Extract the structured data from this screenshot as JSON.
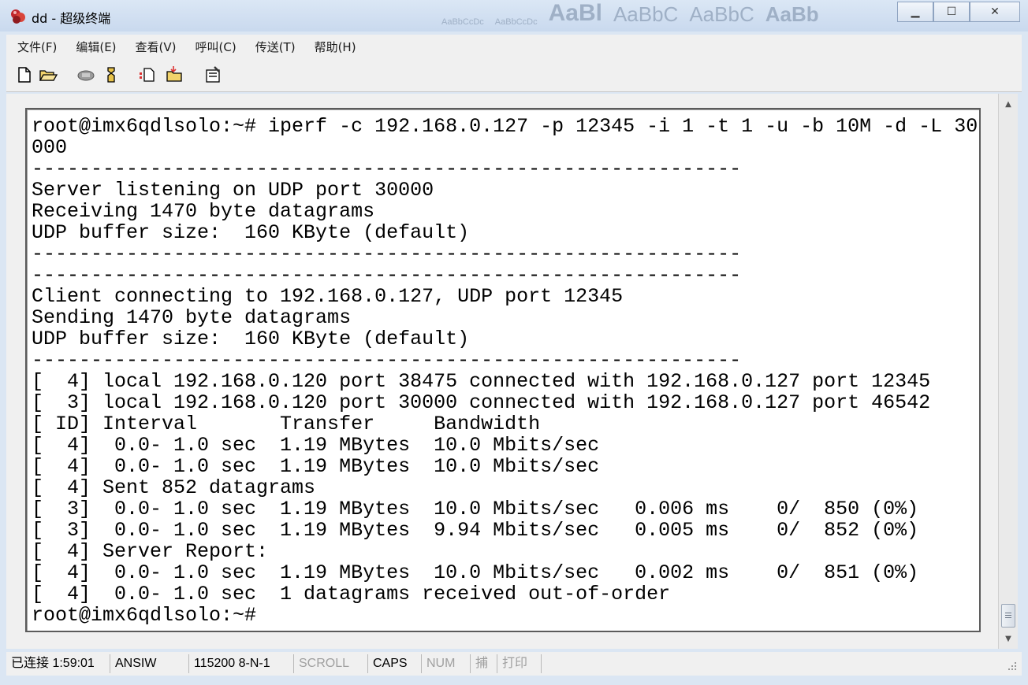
{
  "window": {
    "title": "dd - 超级终端",
    "minimize_label": "▁",
    "maximize_label": "☐",
    "close_label": "✕",
    "background_ribbon": [
      "AaBbCcDc",
      "AaBbCcDc",
      "AaBl",
      "AaBbC",
      "AaBbC",
      "AaBb"
    ]
  },
  "menu": {
    "items": [
      "文件(F)",
      "编辑(E)",
      "查看(V)",
      "呼叫(C)",
      "传送(T)",
      "帮助(H)"
    ]
  },
  "toolbar": {
    "icons": [
      "new-document-icon",
      "open-folder-icon",
      "phone-icon",
      "disconnect-icon",
      "send-file-icon",
      "receive-file-icon",
      "properties-icon"
    ]
  },
  "terminal": {
    "lines": [
      "root@imx6qdlsolo:~# iperf -c 192.168.0.127 -p 12345 -i 1 -t 1 -u -b 10M -d -L 30",
      "000",
      "------------------------------------------------------------",
      "Server listening on UDP port 30000",
      "Receiving 1470 byte datagrams",
      "UDP buffer size:  160 KByte (default)",
      "------------------------------------------------------------",
      "------------------------------------------------------------",
      "Client connecting to 192.168.0.127, UDP port 12345",
      "Sending 1470 byte datagrams",
      "UDP buffer size:  160 KByte (default)",
      "------------------------------------------------------------",
      "[  4] local 192.168.0.120 port 38475 connected with 192.168.0.127 port 12345",
      "[  3] local 192.168.0.120 port 30000 connected with 192.168.0.127 port 46542",
      "[ ID] Interval       Transfer     Bandwidth",
      "[  4]  0.0- 1.0 sec  1.19 MBytes  10.0 Mbits/sec",
      "[  4]  0.0- 1.0 sec  1.19 MBytes  10.0 Mbits/sec",
      "[  4] Sent 852 datagrams",
      "[  3]  0.0- 1.0 sec  1.19 MBytes  10.0 Mbits/sec   0.006 ms    0/  850 (0%)",
      "[  3]  0.0- 1.0 sec  1.19 MBytes  9.94 Mbits/sec   0.005 ms    0/  852 (0%)",
      "[  4] Server Report:",
      "[  4]  0.0- 1.0 sec  1.19 MBytes  10.0 Mbits/sec   0.002 ms    0/  851 (0%)",
      "[  4]  0.0- 1.0 sec  1 datagrams received out-of-order",
      "root@imx6qdlsolo:~#"
    ]
  },
  "status": {
    "connected": "已连接 1:59:01",
    "emulation": "ANSIW",
    "port_settings": "115200 8-N-1",
    "scroll": "SCROLL",
    "caps": "CAPS",
    "num": "NUM",
    "capture": "捕",
    "print": "打印"
  },
  "scrollbar": {
    "up_arrow": "▲",
    "down_arrow": "▼",
    "position": 0.95
  }
}
